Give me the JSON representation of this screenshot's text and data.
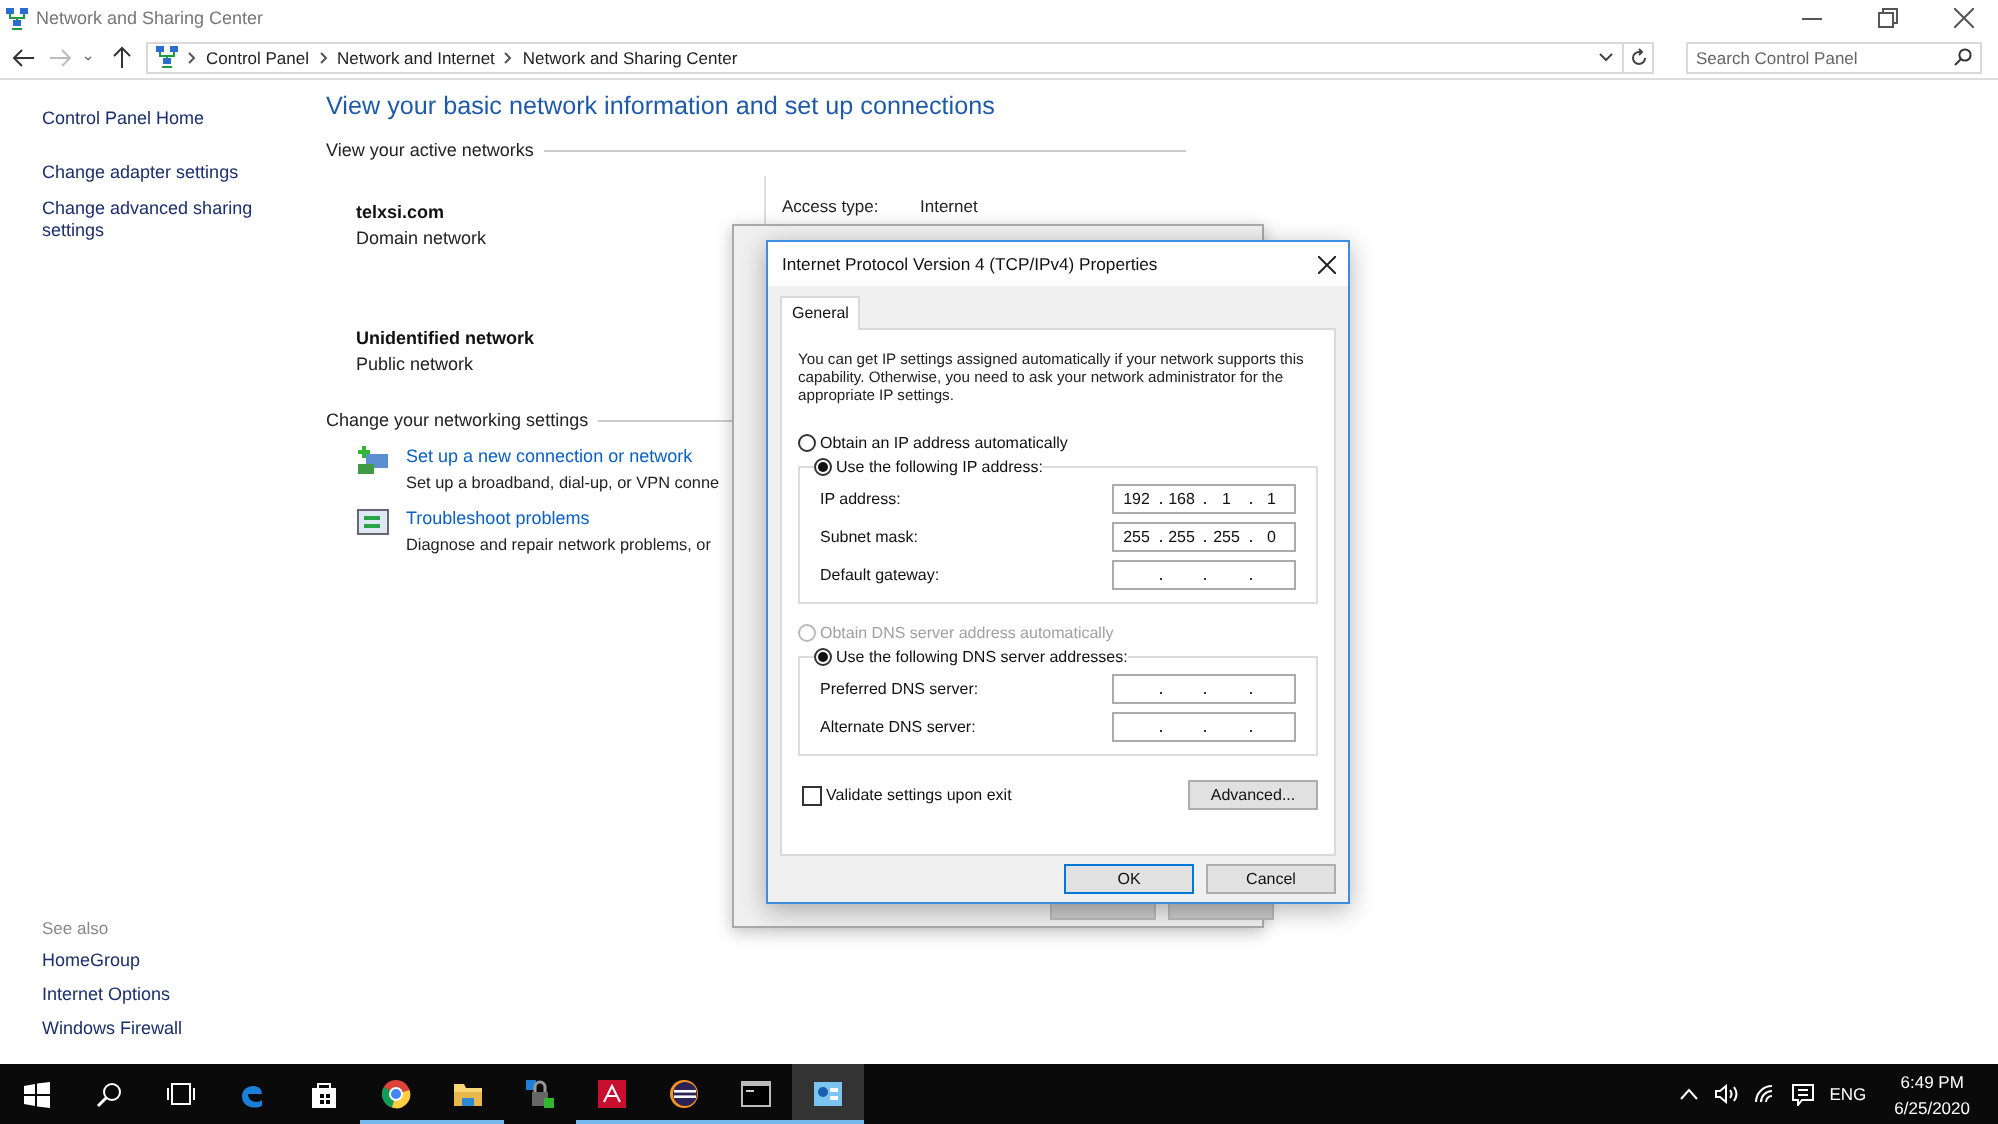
{
  "window": {
    "title": "Network and Sharing Center"
  },
  "address_bar": {
    "crumbs": [
      "Control Panel",
      "Network and Internet",
      "Network and Sharing Center"
    ]
  },
  "search": {
    "placeholder": "Search Control Panel"
  },
  "sidebar": {
    "items": [
      "Control Panel Home",
      "Change adapter settings",
      "Change advanced sharing settings"
    ],
    "see_also_title": "See also",
    "see_also": [
      "HomeGroup",
      "Internet Options",
      "Windows Firewall"
    ]
  },
  "main": {
    "heading": "View your basic network information and set up connections",
    "active_title": "View your active networks",
    "networks": [
      {
        "name": "telxsi.com",
        "category": "Domain network"
      },
      {
        "name": "Unidentified network",
        "category": "Public network"
      }
    ],
    "details": [
      {
        "label": "Access type:",
        "value": "Internet"
      }
    ],
    "settings_title": "Change your networking settings",
    "tasks": [
      {
        "kind": "connection",
        "link": "Set up a new connection or network",
        "description": "Set up a broadband, dial-up, or VPN conne"
      },
      {
        "kind": "troubleshoot",
        "link": "Troubleshoot problems",
        "description": "Diagnose and repair network problems, or"
      }
    ]
  },
  "dialog": {
    "title": "Internet Protocol Version 4 (TCP/IPv4) Properties",
    "tabs": [
      {
        "label": "General",
        "selected": true
      }
    ],
    "intro": "You can get IP settings assigned automatically if your network supports this capability. Otherwise, you need to ask your network administrator for the appropriate IP settings.",
    "ip_modes": [
      {
        "label": "Obtain an IP address automatically",
        "selected": false,
        "disabled": false
      },
      {
        "label": "Use the following IP address:",
        "selected": true,
        "disabled": false
      }
    ],
    "ip_fields": [
      {
        "label": "IP address:",
        "octets": [
          "192",
          "168",
          "1",
          "1"
        ]
      },
      {
        "label": "Subnet mask:",
        "octets": [
          "255",
          "255",
          "255",
          "0"
        ]
      },
      {
        "label": "Default gateway:"
      }
    ],
    "dns_modes": [
      {
        "label": "Obtain DNS server address automatically",
        "selected": false,
        "disabled": true
      },
      {
        "label": "Use the following DNS server addresses:",
        "selected": true,
        "disabled": false
      }
    ],
    "dns_fields": [
      {
        "label": "Preferred DNS server:"
      },
      {
        "label": "Alternate DNS server:"
      }
    ],
    "validate": {
      "label": "Validate settings upon exit",
      "checked": false
    },
    "advanced": "Advanced...",
    "buttons": [
      {
        "label": "OK",
        "default": true
      },
      {
        "label": "Cancel",
        "default": false
      }
    ]
  },
  "taskbar": {
    "apps": [
      {
        "kind": "edge",
        "running": false,
        "selected": false
      },
      {
        "kind": "store",
        "running": false,
        "selected": false
      },
      {
        "kind": "chrome",
        "running": true,
        "selected": false
      },
      {
        "kind": "explorer",
        "running": true,
        "selected": false
      },
      {
        "kind": "vpn",
        "running": false,
        "selected": false
      },
      {
        "kind": "acrobat",
        "running": true,
        "selected": false
      },
      {
        "kind": "eclipse",
        "running": true,
        "selected": false
      },
      {
        "kind": "terminal",
        "running": true,
        "selected": false
      },
      {
        "kind": "controlpanel",
        "running": true,
        "selected": true
      }
    ],
    "language": "ENG",
    "time": "6:49 PM",
    "date": "6/25/2020"
  }
}
